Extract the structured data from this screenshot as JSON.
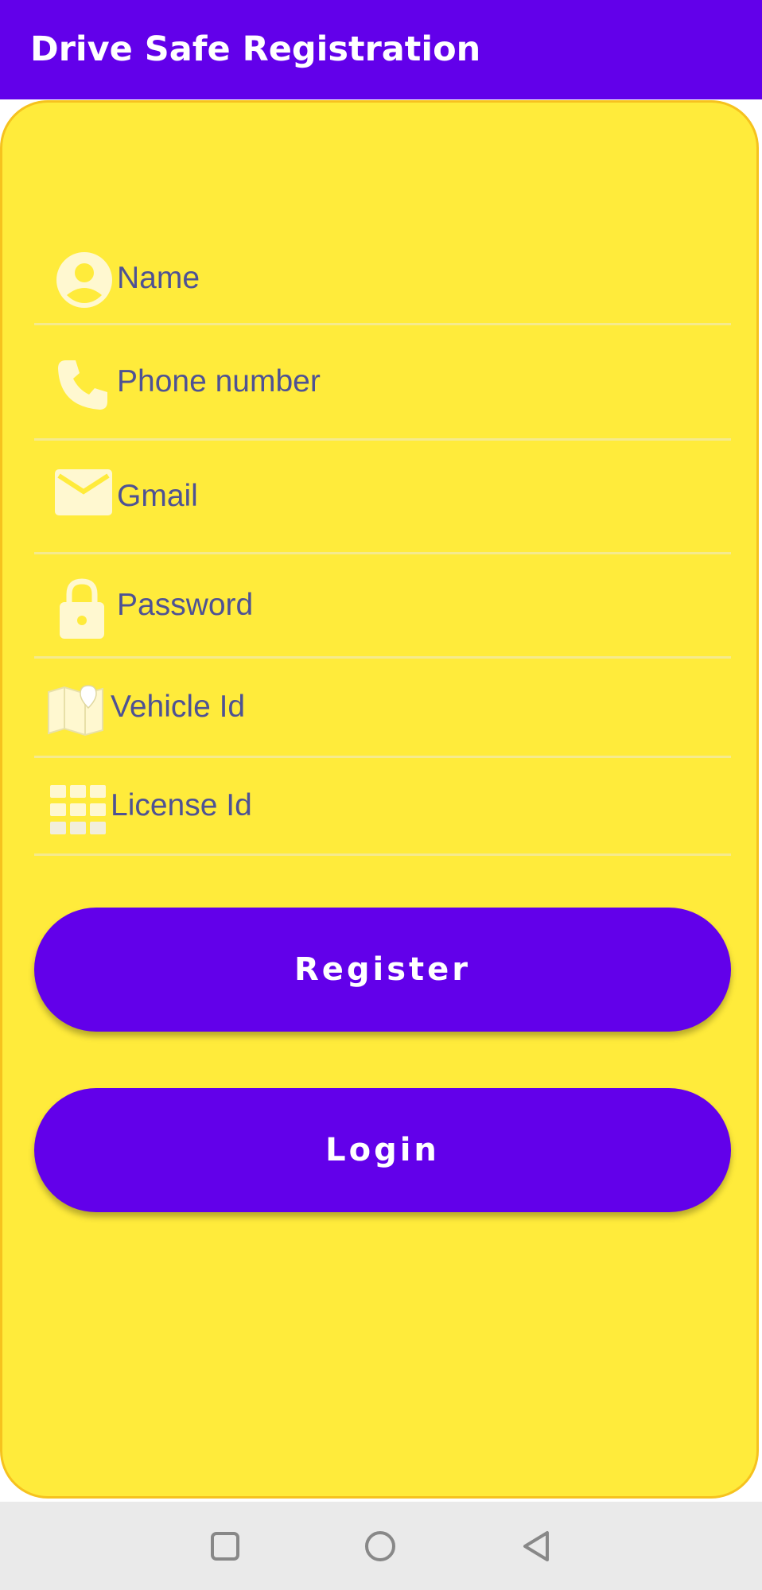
{
  "app_bar": {
    "title": "Drive Safe Registration",
    "color": "#6200EA"
  },
  "form": {
    "background": "#FFEB3B",
    "fields": [
      {
        "icon": "person-icon",
        "placeholder": "Name",
        "value": ""
      },
      {
        "icon": "phone-icon",
        "placeholder": "Phone number",
        "value": ""
      },
      {
        "icon": "mail-icon",
        "placeholder": "Gmail",
        "value": ""
      },
      {
        "icon": "lock-icon",
        "placeholder": "Password",
        "value": ""
      },
      {
        "icon": "map-icon",
        "placeholder": "Vehicle Id",
        "value": ""
      },
      {
        "icon": "grid-icon",
        "placeholder": "License Id",
        "value": ""
      }
    ]
  },
  "buttons": {
    "register_label": "Register",
    "login_label": "Login"
  },
  "nav_bar": {
    "items": [
      "recents-button",
      "home-button",
      "back-button"
    ]
  }
}
